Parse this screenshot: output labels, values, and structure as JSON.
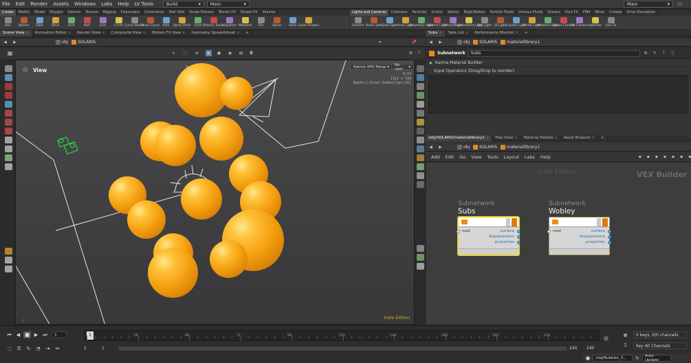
{
  "menubar": {
    "items": [
      "File",
      "Edit",
      "Render",
      "Assets",
      "Windows",
      "Labs",
      "Help",
      "LV Tools"
    ],
    "desktop": "Build",
    "network": "Main",
    "right_label": "Main"
  },
  "shelf_left": {
    "tabs": [
      "Create",
      "Modify",
      "Model",
      "Polygon",
      "Deform",
      "Texture",
      "Rigging",
      "Characters",
      "Constraints",
      "Hair Utils",
      "Guide Process",
      "Terrain FX",
      "Simple FX",
      "Volume"
    ],
    "tools": [
      "Box",
      "Sphere",
      "Tube",
      "Torus",
      "Grid",
      "Null",
      "Line",
      "Circle",
      "Curve Bezier",
      "Draw Curve",
      "Path",
      "Spray Paint",
      "Font",
      "Platonic Solids",
      "L-System",
      "Metaball",
      "File",
      "Spiral",
      "Helix",
      "Quick Shapes"
    ]
  },
  "shelf_right": {
    "tabs": [
      "Lights and Cameras",
      "Collisions",
      "Particles",
      "Grains",
      "Vellum",
      "Rigid Bodies",
      "Particle Fluids",
      "Viscous Fluids",
      "Oceans",
      "Pyro FX",
      "FEM",
      "Wires",
      "Crowds",
      "Drive Simulation"
    ],
    "tools": [
      "Camera",
      "Point Light",
      "Spot Light",
      "Area Light",
      "Geometry Light",
      "Volume Light",
      "Distant Light",
      "Environment Light",
      "Sky Light",
      "GI Light",
      "Caustic Light",
      "Portal Light",
      "Ambient Light",
      "Stereo Camera",
      "VR Camera",
      "Switcher",
      "Gas Ca"
    ]
  },
  "left_panes": {
    "tabs": [
      "Scene View",
      "Animation Editor",
      "Render View",
      "Composite View",
      "Motion FX View",
      "Geometry Spreadsheet"
    ],
    "path": [
      "obj",
      "SOLARIS"
    ]
  },
  "viewport": {
    "label": "View",
    "renderer": "Karma XPU",
    "persp": "Persp",
    "cam": "No cam",
    "stats": [
      "0:13",
      "1112 x 720",
      "Depth:1,Pixel:IndexClips(16)"
    ],
    "watermark": "Indie Edition"
  },
  "param_pane": {
    "tabs": [
      "Subs",
      "Take List",
      "Performance Monitor"
    ],
    "path": [
      "obj",
      "SOLARIS",
      "materiallibrary1"
    ],
    "node_type": "Subnetwork",
    "node_name": "Subs",
    "section": "Karma Material Builder",
    "input_ops": "Input Operators (Drag/Drop to reorder)"
  },
  "network_pane": {
    "tabs": [
      "/obj/SOLARIS/materiallibrary1",
      "Tree View",
      "Material Palette",
      "Asset Browser"
    ],
    "path": [
      "obj",
      "SOLARIS",
      "materiallibrary1"
    ],
    "menu": [
      "Add",
      "Edit",
      "Go",
      "View",
      "Tools",
      "Layout",
      "Labs",
      "Help"
    ],
    "watermark": "Indie Edition",
    "context": "VEX Builder",
    "nodes": [
      {
        "type": "Subnetwork",
        "name": "Subs",
        "input": "next",
        "outputs": [
          "surface",
          "displacement",
          "properties"
        ]
      },
      {
        "type": "Subnetwork",
        "name": "Wobley",
        "input": "next",
        "outputs": [
          "surface",
          "displacement",
          "properties"
        ]
      }
    ]
  },
  "timeline": {
    "ticks": [
      "24",
      "48",
      "72",
      "96",
      "120",
      "144",
      "168",
      "192",
      "216"
    ],
    "current": "1",
    "start": "1",
    "range_start": "1",
    "end": "240",
    "range_end": "240",
    "keys": "0 keys, 0/0 channels",
    "key_channels": "Key All Channels",
    "status_path": "/obj/Bubbles_S...",
    "auto_update": "Auto Update"
  },
  "colors": {
    "accent": "#f4a010",
    "selected": "#e8d23a"
  }
}
